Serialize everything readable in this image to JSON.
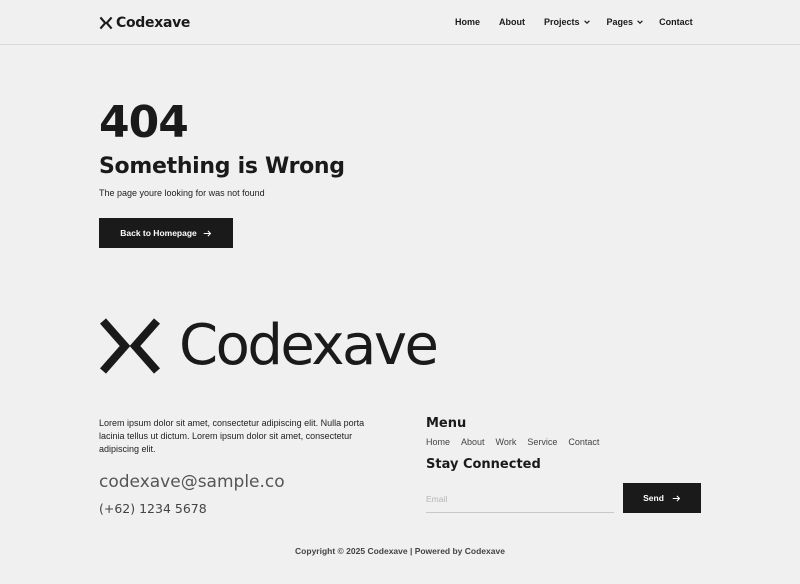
{
  "header": {
    "logo_text": "Codexave",
    "nav": [
      {
        "label": "Home"
      },
      {
        "label": "About"
      },
      {
        "label": "Projects",
        "has_dropdown": true
      },
      {
        "label": "Pages",
        "has_dropdown": true
      },
      {
        "label": "Contact"
      }
    ]
  },
  "error": {
    "code": "404",
    "title": "Something is Wrong",
    "subtitle": "The page youre looking for was not found",
    "button_label": "Back to Homepage",
    "button_icon": "arrow-right-icon"
  },
  "footer": {
    "logo_text": "Codexave",
    "about": "Lorem ipsum dolor sit amet, consectetur adipiscing elit. Nulla porta lacinia tellus ut dictum. Lorem ipsum dolor sit amet, consectetur adipiscing elit.",
    "email": "codexave@sample.co",
    "phone": "(+62) 1234 5678",
    "menu_title": "Menu",
    "menu_links": [
      "Home",
      "About",
      "Work",
      "Service",
      "Contact"
    ],
    "stay_title": "Stay Connected",
    "email_placeholder": "Email",
    "send_label": "Send",
    "copyright": "Copyright © 2025 Codexave | Powered by Codexave"
  },
  "colors": {
    "background": "#f0f0f0",
    "primary_dark": "#1a1a1a",
    "button_text": "#ffffff"
  }
}
